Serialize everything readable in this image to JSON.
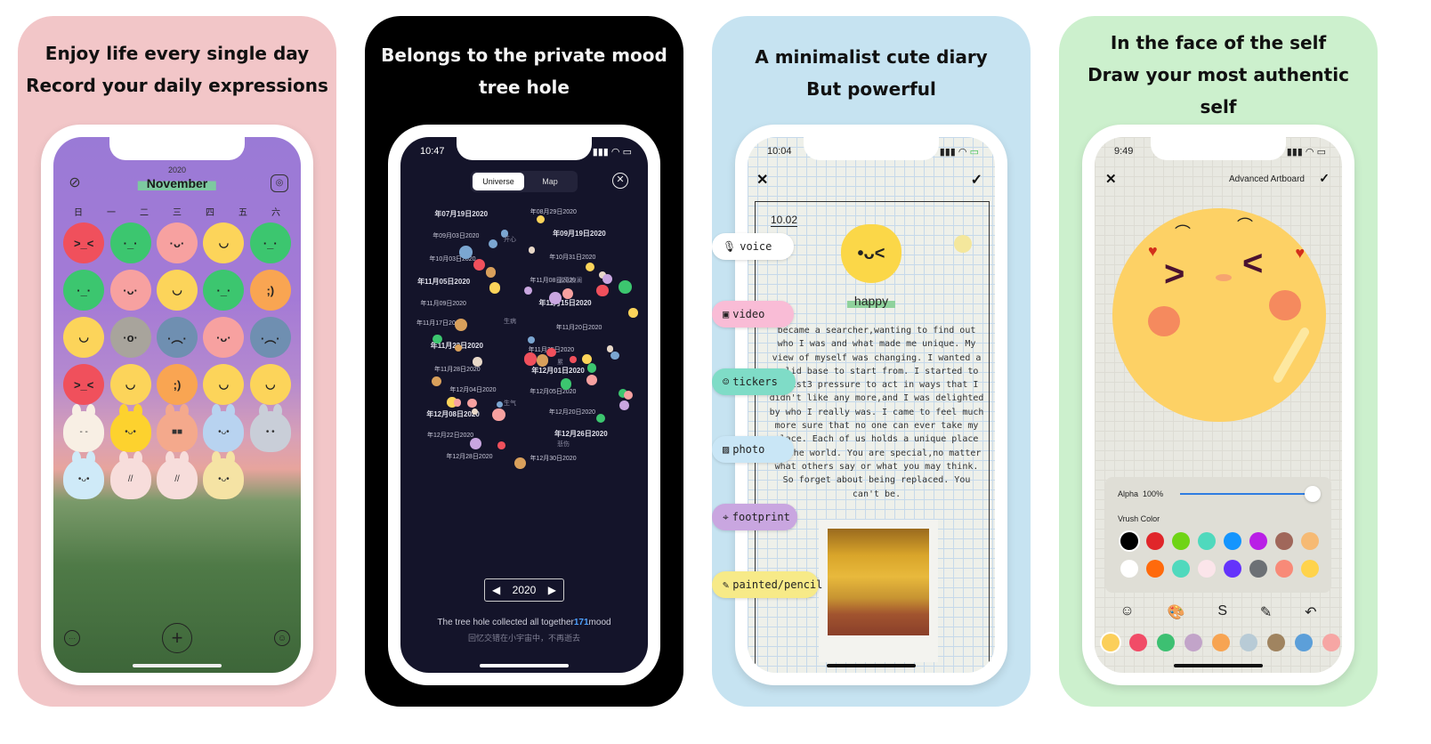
{
  "panels": [
    {
      "headline": [
        "Enjoy life every single day",
        "Record your daily expressions"
      ],
      "calendar": {
        "year": "2020",
        "month": "November",
        "weekdays": [
          "日",
          "一",
          "二",
          "三",
          "四",
          "五",
          "六"
        ],
        "left_icon": "mood-stats-icon",
        "right_icon": "instagram-icon",
        "moods": [
          {
            "color": "#f0505c",
            "face": ">_<"
          },
          {
            "color": "#3cc66f",
            "face": "·_·"
          },
          {
            "color": "#f7a1a0",
            "face": "·ᴗ·"
          },
          {
            "color": "#fcd45a",
            "face": "◡"
          },
          {
            "color": "#3cc66f",
            "face": "·_·"
          },
          {
            "color": "#3cc66f",
            "face": "·_·"
          },
          {
            "color": "#f7a1a0",
            "face": "·ᴗ·"
          },
          {
            "color": "#fcd45a",
            "face": "◡"
          },
          {
            "color": "#3cc66f",
            "face": "·_·"
          },
          {
            "color": "#f9a552",
            "face": ";)"
          },
          {
            "color": "#fcd45a",
            "face": "◡"
          },
          {
            "color": "#a8a49c",
            "face": "·o·"
          },
          {
            "color": "#6f8fb1",
            "face": "·︵·"
          },
          {
            "color": "#f7a1a0",
            "face": "·ᴗ·"
          },
          {
            "color": "#6f8fb1",
            "face": "·︵·"
          },
          {
            "color": "#f0505c",
            "face": ">_<"
          },
          {
            "color": "#fcd45a",
            "face": "◡"
          },
          {
            "color": "#f9a552",
            "face": ";)"
          },
          {
            "color": "#fcd45a",
            "face": "◡"
          },
          {
            "color": "#fcd45a",
            "face": "◡"
          }
        ],
        "bunnies": [
          {
            "color": "#f8efe4",
            "face": "- -"
          },
          {
            "color": "#fdd22e",
            "face": "•ᴗ•"
          },
          {
            "color": "#f4a98c",
            "face": "■■"
          },
          {
            "color": "#b8d3f0",
            "face": "•ᴗ•"
          },
          {
            "color": "#c9ced8",
            "face": "• •"
          },
          {
            "color": "#cfeaf8",
            "face": "•ᴗ•"
          },
          {
            "color": "#f7dddb",
            "face": "//"
          },
          {
            "color": "#f7dddb",
            "face": "//"
          },
          {
            "color": "#f5e3a4",
            "face": "•ᴗ•"
          }
        ],
        "bottom_icons": [
          "more-icon",
          "add-icon",
          "smiley-icon"
        ]
      }
    },
    {
      "headline": [
        "Belongs to the private mood",
        "tree hole"
      ],
      "status_time": "10:47",
      "tabs": [
        "Universe",
        "Map"
      ],
      "active_tab": "Universe",
      "universe_labels": [
        "年07月19日2020",
        "年08月29日2020",
        "年09月03日2020",
        "年09月19日2020",
        "年10月03日2020",
        "年10月31日2020",
        "年11月05日2020",
        "年11月08日2020",
        "年11月09日2020",
        "年11月15日2020",
        "年11月17日2020",
        "年11月20日2020",
        "年11月23日2020",
        "年11月25日2020",
        "年11月28日2020",
        "年12月01日2020",
        "年12月04日2020",
        "年12月05日2020",
        "年12月08日2020",
        "年12月20日2020",
        "年12月22日2020",
        "年12月26日2020",
        "年12月28日2020",
        "年12月30日2020"
      ],
      "universe_tags": [
        "开心",
        "毫无波澜",
        "生病",
        "累",
        "生气",
        "悲伤"
      ],
      "year": "2020",
      "caption_prefix": "The tree hole collected all together",
      "count": "171",
      "caption_suffix": "mood",
      "subcaption": "回忆交错在小宇宙中，不再逝去"
    },
    {
      "headline": [
        "A minimalist cute diary",
        "But powerful"
      ],
      "status_time": "10:04",
      "date": "10.02",
      "mood": "happy",
      "text": "became a searcher,wanting to find out who I was and what made me unique. My view of myself was changing. I wanted a solid base to start from. I started to resist3 pressure to act in ways that I didn't like any more,and I was delighted by who I really was. I came to feel much more sure that no one can ever take my place. Each of us holds a unique place in the world. You are special,no matter what others say or what you may think. So forget about being replaced. You can't be.",
      "tools": [
        {
          "label": "voice",
          "icon": "microphone-icon",
          "glyph": "🎙",
          "color": "#ffffff"
        },
        {
          "label": "video",
          "icon": "video-icon",
          "glyph": "▣",
          "color": "#f9bcd6"
        },
        {
          "label": "tickers",
          "icon": "sticker-icon",
          "glyph": "☺",
          "color": "#7fdcc7"
        },
        {
          "label": "photo",
          "icon": "photo-icon",
          "glyph": "▨",
          "color": "#c9e6f6"
        },
        {
          "label": "footprint",
          "icon": "map-pin-icon",
          "glyph": "⌖",
          "color": "#c9a6e0"
        },
        {
          "label": "painted/pencil",
          "icon": "pencil-icon",
          "glyph": "✎",
          "color": "#f7ea88"
        }
      ]
    },
    {
      "headline": [
        "In the face of the self",
        "Draw your most authentic",
        "self"
      ],
      "status_time": "9:49",
      "artboard_title": "Advanced Artboard",
      "alpha_label": "Alpha",
      "alpha_value": "100%",
      "alpha_fraction": 1.0,
      "brush_color_label": "Vrush Color",
      "palette": [
        "#000000",
        "#e0262a",
        "#6fd415",
        "#4fd9bd",
        "#1495fe",
        "#b91fe6",
        "#a0675a",
        "#f6ba74",
        "#ffffff",
        "#ff6a0c",
        "#4fd9bd",
        "#fbe5ea",
        "#6433fb",
        "#6c7075",
        "#f88a78",
        "#ffd34b"
      ],
      "selected_palette_index": 0,
      "toolbar_icons": [
        "emoji-icon",
        "palette-icon",
        "stroke-icon",
        "pencil-icon",
        "undo-icon"
      ],
      "toolbar_glyphs": [
        "☺",
        "🎨",
        "S",
        "✎",
        "↶"
      ],
      "recent_colors": [
        "#fbcf5a",
        "#f14c67",
        "#3dc072",
        "#c2a4c9",
        "#f7a452",
        "#b8cbd6",
        "#a08460",
        "#5c9fd9",
        "#f6a6a4"
      ]
    }
  ],
  "status_icons": {
    "signal": "signal-icon",
    "wifi": "wifi-icon",
    "battery": "battery-icon"
  }
}
